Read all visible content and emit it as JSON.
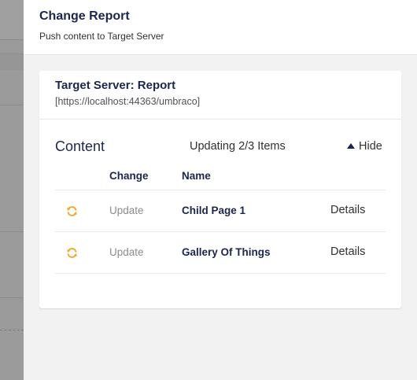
{
  "header": {
    "title": "Change Report",
    "subtitle": "Push content to Target Server"
  },
  "server": {
    "title": "Target Server: Report",
    "url": "[https://localhost:44363/umbraco]"
  },
  "content": {
    "label": "Content",
    "status": "Updating 2/3 Items",
    "toggle_label": "Hide",
    "toggle_icon": "triangle-up-icon",
    "columns": {
      "change": "Change",
      "name": "Name"
    },
    "rows": [
      {
        "icon": "sync-icon",
        "change": "Update",
        "name": "Child Page 1",
        "details": "Details"
      },
      {
        "icon": "sync-icon",
        "change": "Update",
        "name": "Gallery Of Things",
        "details": "Details"
      }
    ]
  },
  "colors": {
    "accent_orange": "#f5a623",
    "title_navy": "#1b264f",
    "panel_bg": "#f3f2f3",
    "overlay_gray": "#9a9a9a"
  }
}
